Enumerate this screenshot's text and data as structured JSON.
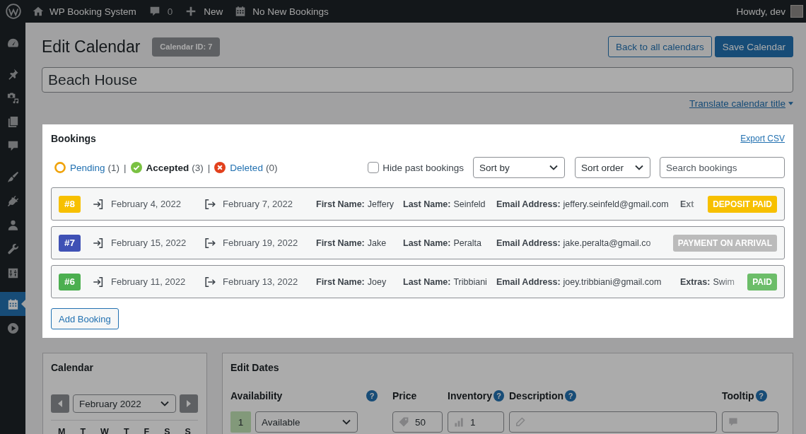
{
  "admin_bar": {
    "site_name": "WP Booking System",
    "comments": "0",
    "new": "New",
    "notice": "No New Bookings",
    "greeting": "Howdy, dev"
  },
  "sidebar": {
    "items": [
      {
        "selected": false
      },
      {
        "selected": false
      },
      {
        "selected": false
      },
      {
        "selected": false
      },
      {
        "selected": false
      },
      {
        "selected": false
      },
      {
        "selected": false
      },
      {
        "selected": false
      },
      {
        "selected": false
      },
      {
        "selected": false
      },
      {
        "selected": true
      },
      {
        "selected": false
      }
    ]
  },
  "page": {
    "title": "Edit Calendar",
    "badge": "Calendar ID: 7",
    "buttons": [
      {
        "label": "Back to all calendars",
        "kind": "secondary"
      },
      {
        "label": "Save Calendar",
        "kind": "primary"
      }
    ],
    "calendar_title": "Beach House",
    "translate_link": "Translate calendar title"
  },
  "bookings": {
    "highlighted": true,
    "title": "Bookings",
    "export": "Export CSV",
    "statuses": [
      {
        "kind": "pending",
        "label": "Pending",
        "count": "(1)",
        "selected": false,
        "separator": "|"
      },
      {
        "kind": "accepted",
        "label": "Accepted",
        "count": "(3)",
        "selected": true,
        "separator": "|"
      },
      {
        "kind": "deleted",
        "label": "Deleted",
        "count": "(0)",
        "selected": false
      }
    ],
    "hide_past": {
      "label": "Hide past bookings",
      "checked": false
    },
    "sort_by": "Sort by",
    "sort_order": "Sort order",
    "search": {
      "placeholder": "Search bookings"
    },
    "rows": [
      {
        "id": "#8",
        "color": "#f7c000",
        "check_in": "February 4, 2022",
        "check_out": "February 7, 2022",
        "fields": [
          {
            "label": "First Name:",
            "value": "Jeffery"
          },
          {
            "label": "Last Name:",
            "value": "Seinfeld"
          },
          {
            "label": "Email Address:",
            "value": "jeffery.seinfeld@gmail.com"
          },
          {
            "label": "Ext"
          }
        ],
        "payment": {
          "label": "DEPOSIT PAID",
          "color": "#f7c000"
        }
      },
      {
        "id": "#7",
        "color": "#3f51b5",
        "check_in": "February 15, 2022",
        "check_out": "February 19, 2022",
        "fields": [
          {
            "label": "First Name:",
            "value": "Jake"
          },
          {
            "label": "Last Name:",
            "value": "Peralta"
          },
          {
            "label": "Email Address:",
            "value": "jake.peralta@gmail.co"
          }
        ],
        "payment": {
          "label": "PAYMENT ON ARRIVAL",
          "color": "#bbbbbb"
        }
      },
      {
        "id": "#6",
        "color": "#4caf50",
        "check_in": "February 11, 2022",
        "check_out": "February 13, 2022",
        "fields": [
          {
            "label": "First Name:",
            "value": "Joey"
          },
          {
            "label": "Last Name:",
            "value": "Tribbiani"
          },
          {
            "label": "Email Address:",
            "value": "joey.tribbiani@gmail.com"
          },
          {
            "label": "Extras:",
            "value": "Swim"
          }
        ],
        "payment": {
          "label": "PAID",
          "color": "#6cbd69"
        }
      }
    ],
    "add_button": "Add Booking"
  },
  "calendar": {
    "title": "Calendar",
    "month": "February 2022",
    "weekdays": [
      "M",
      "T",
      "W",
      "T",
      "F",
      "S",
      "S"
    ]
  },
  "edit_dates": {
    "title": "Edit Dates",
    "columns": [
      {
        "kind": "availability",
        "label": "Availability",
        "help": "?",
        "count": "1",
        "value": "Available"
      },
      {
        "kind": "price",
        "label": "Price",
        "value": "50"
      },
      {
        "kind": "inventory",
        "label": "Inventory",
        "help": "?",
        "value": "1"
      },
      {
        "kind": "description",
        "label": "Description",
        "help": "?"
      },
      {
        "kind": "tooltip",
        "label": "Tooltip",
        "help": "?"
      }
    ]
  }
}
